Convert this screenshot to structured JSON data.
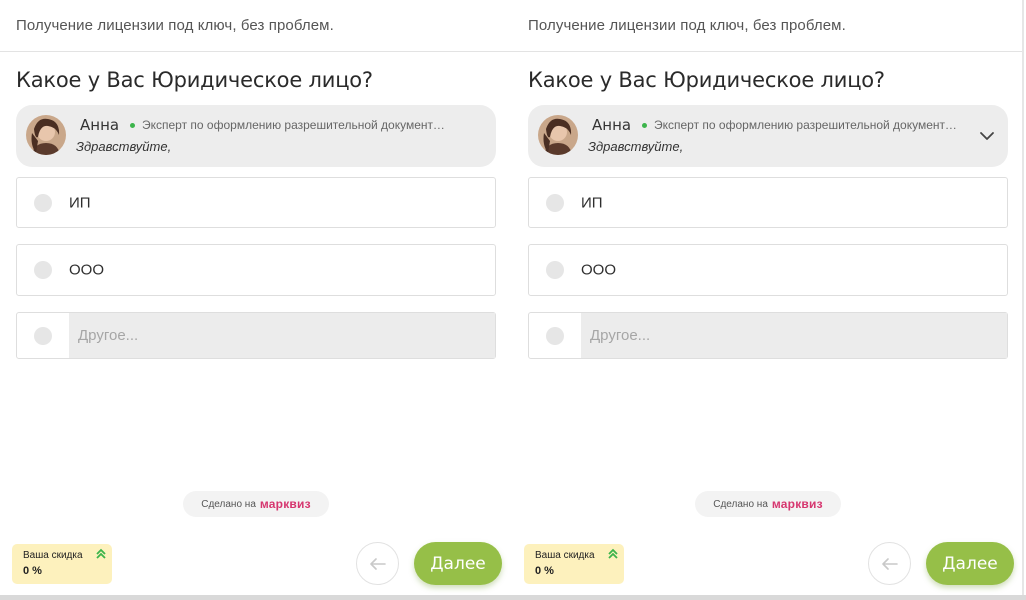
{
  "panels": [
    {
      "id": "left",
      "header_subtitle": "Получение лицензии под ключ, без проблем.",
      "question": "Какое у Вас Юридическое лицо?",
      "expert": {
        "name": "Анна",
        "role": "Эксперт по оформлению разрешительной документации",
        "greeting": "Здравствуйте,",
        "expandable": false
      },
      "options": [
        {
          "label": "ИП"
        },
        {
          "label": "ООО"
        }
      ],
      "other_placeholder": "Другое...",
      "made_on_prefix": "Сделано на",
      "made_on_brand": "марквиз",
      "discount_label": "Ваша скидка",
      "discount_value": "0 %",
      "next_label": "Далее"
    },
    {
      "id": "right",
      "header_subtitle": "Получение лицензии под ключ, без проблем.",
      "question": "Какое у Вас Юридическое лицо?",
      "expert": {
        "name": "Анна",
        "role": "Эксперт по оформлению разрешительной документации",
        "greeting": "Здравствуйте,",
        "expandable": true
      },
      "options": [
        {
          "label": "ИП"
        },
        {
          "label": "ООО"
        }
      ],
      "other_placeholder": "Другое...",
      "made_on_prefix": "Сделано на",
      "made_on_brand": "марквиз",
      "discount_label": "Ваша скидка",
      "discount_value": "0 %",
      "next_label": "Далее"
    }
  ],
  "colors": {
    "accent_green": "#96bf48",
    "brand_pink": "#d6366f",
    "discount_bg": "#fdf1bd",
    "online_green": "#3cb44b"
  },
  "icons": {
    "back": "arrow-left-icon",
    "expand": "chevron-down-icon",
    "discount": "double-chevron-up-icon",
    "online": "online-status-dot"
  }
}
